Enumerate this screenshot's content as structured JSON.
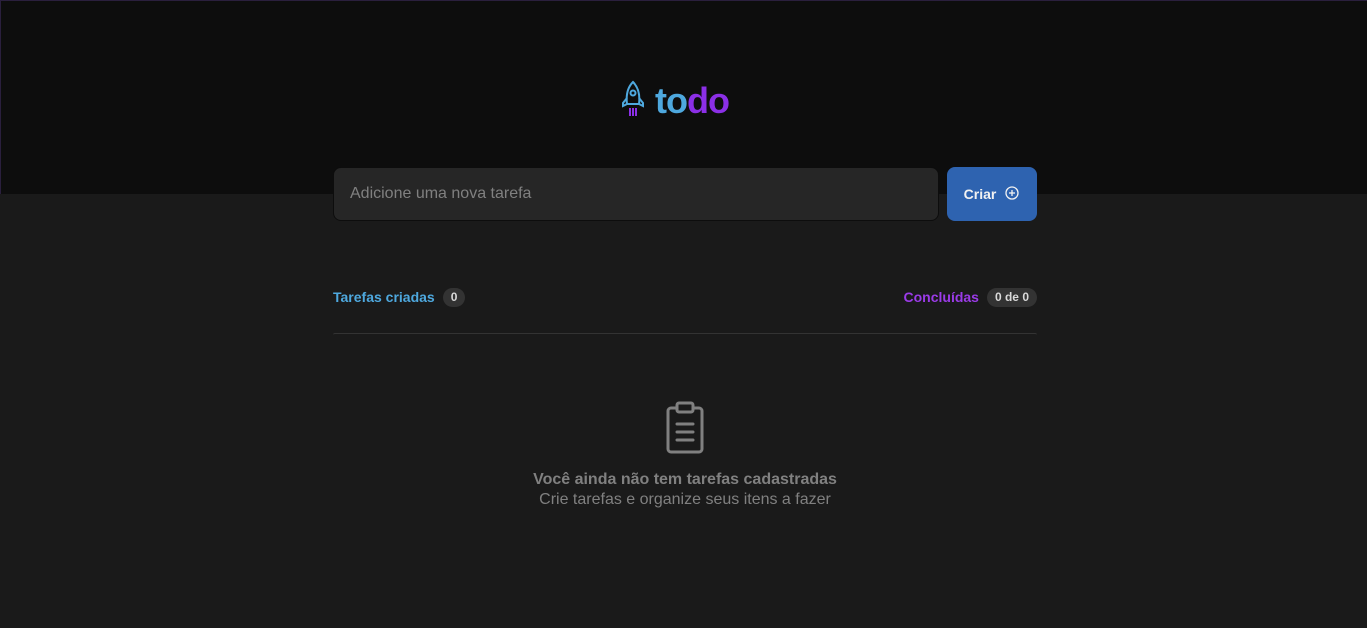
{
  "logo": {
    "part1": "to",
    "part2": "do",
    "icon": "rocket-icon"
  },
  "new_task": {
    "placeholder": "Adicione uma nova tarefa",
    "value": ""
  },
  "create_button": {
    "label": "Criar",
    "icon": "plus-circle-icon"
  },
  "counters": {
    "created_label": "Tarefas criadas",
    "created_count": "0",
    "done_label": "Concluídas",
    "done_count": "0 de 0"
  },
  "empty_state": {
    "icon": "clipboard-icon",
    "title": "Você ainda não tem tarefas cadastradas",
    "subtitle": "Crie tarefas e organize seus itens a fazer"
  },
  "colors": {
    "accent_blue": "#4ea8de",
    "accent_purple": "#8b2fe6",
    "button_blue": "#2e63b0",
    "header_bg": "#0d0d0d",
    "page_bg": "#1a1a1a"
  }
}
